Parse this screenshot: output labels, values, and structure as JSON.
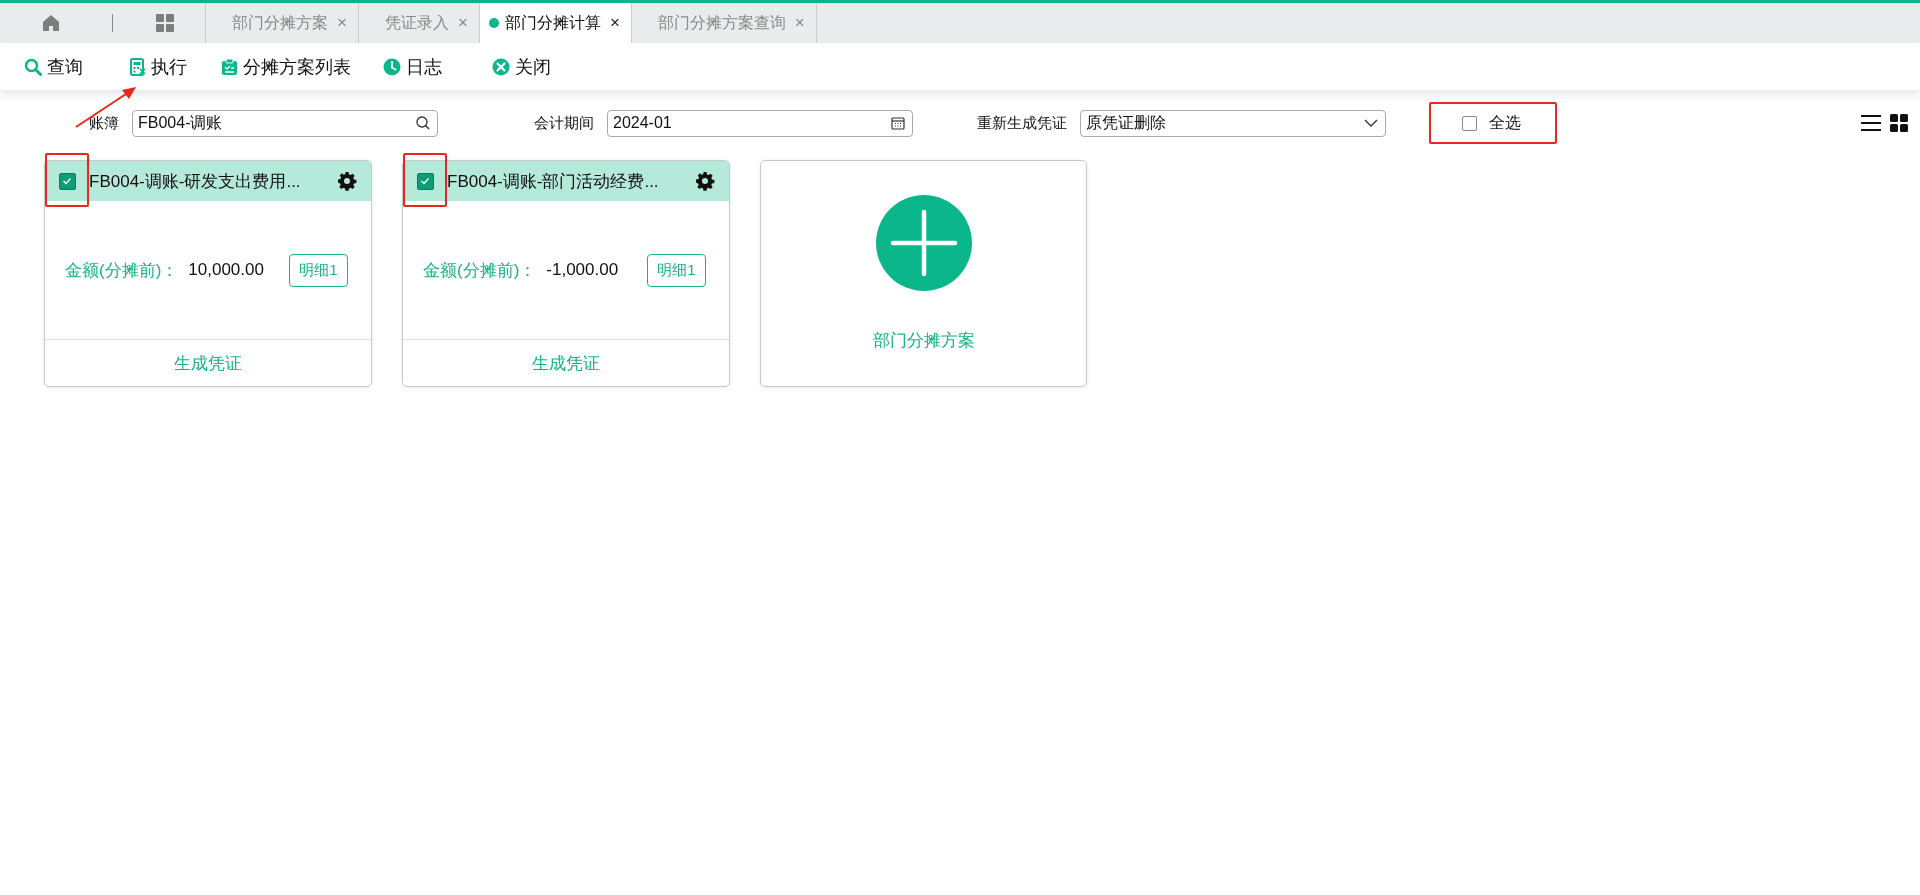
{
  "tabs": [
    {
      "label": "部门分摊方案",
      "selected": false,
      "close": "×"
    },
    {
      "label": "凭证录入",
      "selected": false,
      "close": "×"
    },
    {
      "label": "部门分摊计算",
      "selected": true,
      "close": "×"
    },
    {
      "label": "部门分摊方案查询",
      "selected": false,
      "close": "×"
    }
  ],
  "toolbar": [
    {
      "kind": "search",
      "label": "查询"
    },
    {
      "kind": "calc",
      "label": "执行"
    },
    {
      "kind": "clipboard",
      "label": "分摊方案列表"
    },
    {
      "kind": "clock",
      "label": "日志"
    },
    {
      "kind": "close",
      "label": "关闭"
    }
  ],
  "filters": {
    "ledger": {
      "label": "账簿",
      "value": "FB004-调账"
    },
    "period": {
      "label": "会计期间",
      "value": "2024-01"
    },
    "regenerate": {
      "label": "重新生成凭证",
      "value": "原凭证删除"
    },
    "select_all": {
      "label": "全选",
      "checked": false
    }
  },
  "cards": [
    {
      "title": "FB004-调账-研发支出费用...",
      "checked": true,
      "amount_label": "金额(分摊前)：",
      "amount": "10,000.00",
      "detail": "明细1",
      "action": "生成凭证"
    },
    {
      "title": "FB004-调账-部门活动经费...",
      "checked": true,
      "amount_label": "金额(分摊前)：",
      "amount": "-1,000.00",
      "detail": "明细1",
      "action": "生成凭证"
    }
  ],
  "add_card": {
    "label": "部门分摊方案"
  }
}
